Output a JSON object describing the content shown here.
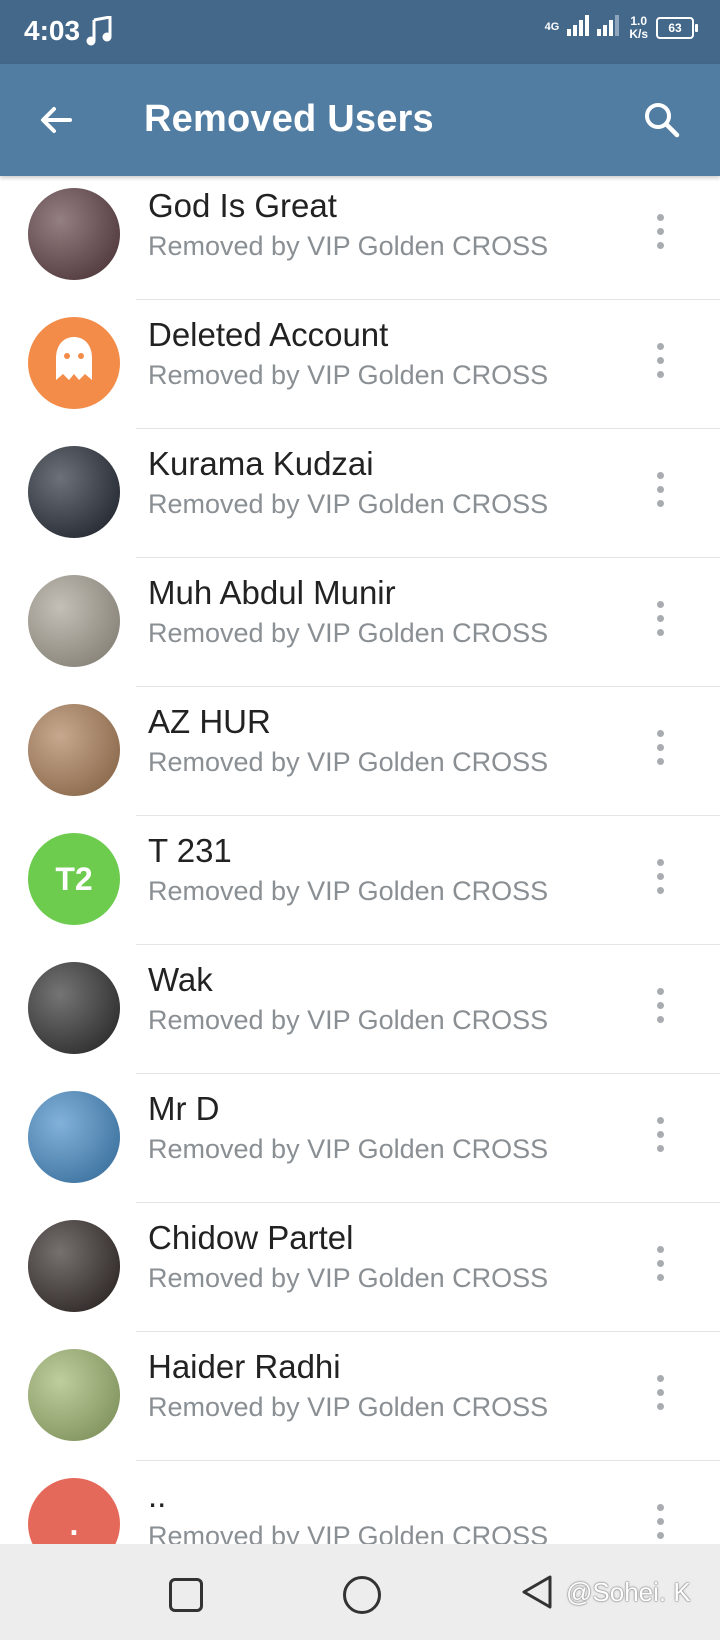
{
  "status_bar": {
    "time": "4:03",
    "network": "4G",
    "speed_value": "1.0",
    "speed_unit": "K/s",
    "battery": "63"
  },
  "toolbar": {
    "title": "Removed Users"
  },
  "removed_users": [
    {
      "name": "God Is Great",
      "subtitle": "Removed by VIP Golden CROSS",
      "avatar_type": "photo",
      "avatar_color": "#5a3a3e"
    },
    {
      "name": "Deleted Account",
      "subtitle": "Removed by VIP Golden CROSS",
      "avatar_type": "ghost-icon",
      "avatar_color": "#f28c48"
    },
    {
      "name": "Kurama Kudzai",
      "subtitle": "Removed by VIP Golden CROSS",
      "avatar_type": "photo",
      "avatar_color": "#1e2430"
    },
    {
      "name": "Muh Abdul Munir",
      "subtitle": "Removed by VIP Golden CROSS",
      "avatar_type": "photo",
      "avatar_color": "#a39d8f"
    },
    {
      "name": "AZ HUR",
      "subtitle": "Removed by VIP Golden CROSS",
      "avatar_type": "photo",
      "avatar_color": "#a97a52"
    },
    {
      "name": "T 231",
      "subtitle": "Removed by VIP Golden CROSS",
      "avatar_type": "initials",
      "initials": "T2",
      "avatar_color": "#6dcb4e"
    },
    {
      "name": "Wak",
      "subtitle": "Removed by VIP Golden CROSS",
      "avatar_type": "photo",
      "avatar_color": "#2a2a2a"
    },
    {
      "name": "Mr D",
      "subtitle": "Removed by VIP Golden CROSS",
      "avatar_type": "photo",
      "avatar_color": "#3f88c5"
    },
    {
      "name": "Chidow Partel",
      "subtitle": "Removed by VIP Golden CROSS",
      "avatar_type": "photo",
      "avatar_color": "#2c2320"
    },
    {
      "name": "Haider Radhi",
      "subtitle": "Removed by VIP Golden CROSS",
      "avatar_type": "photo",
      "avatar_color": "#9bb46a"
    },
    {
      "name": "..",
      "subtitle": "Removed by VIP Golden CROSS",
      "avatar_type": "initials",
      "initials": ".",
      "avatar_color": "#e5695a"
    }
  ],
  "watermark": "@Sohei. K"
}
